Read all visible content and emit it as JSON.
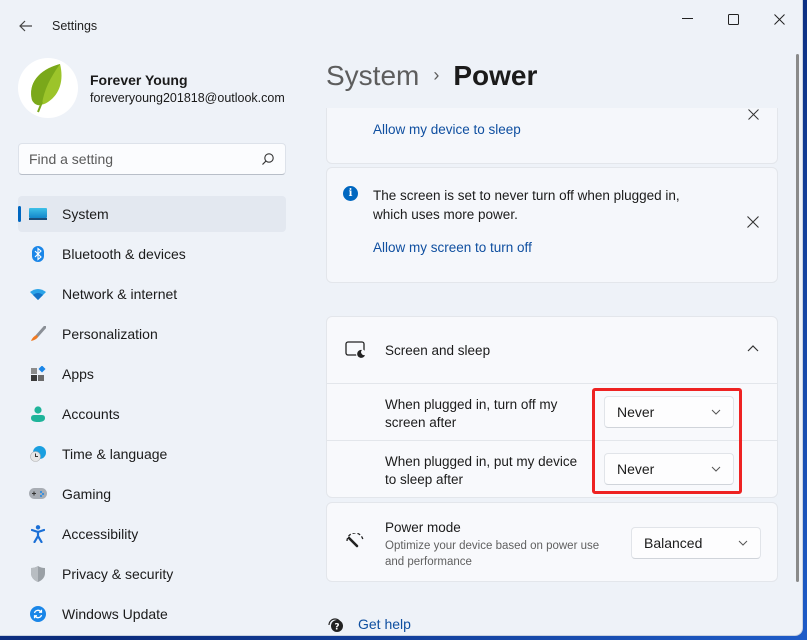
{
  "window": {
    "title": "Settings",
    "back_icon": "arrow-left-icon",
    "controls": {
      "minimize": "minimize-icon",
      "maximize": "maximize-icon",
      "close": "close-icon"
    }
  },
  "profile": {
    "name": "Forever Young",
    "email": "foreveryoung201818@outlook.com",
    "avatar_icon": "leaf-icon"
  },
  "search": {
    "placeholder": "Find a setting",
    "value": "",
    "icon": "search-icon"
  },
  "sidebar": {
    "items": [
      {
        "label": "System",
        "icon": "system-display-icon",
        "active": true
      },
      {
        "label": "Bluetooth & devices",
        "icon": "bluetooth-icon",
        "active": false
      },
      {
        "label": "Network & internet",
        "icon": "wifi-icon",
        "active": false
      },
      {
        "label": "Personalization",
        "icon": "paintbrush-icon",
        "active": false
      },
      {
        "label": "Apps",
        "icon": "apps-icon",
        "active": false
      },
      {
        "label": "Accounts",
        "icon": "person-icon",
        "active": false
      },
      {
        "label": "Time & language",
        "icon": "clock-globe-icon",
        "active": false
      },
      {
        "label": "Gaming",
        "icon": "gamepad-icon",
        "active": false
      },
      {
        "label": "Accessibility",
        "icon": "accessibility-icon",
        "active": false
      },
      {
        "label": "Privacy & security",
        "icon": "shield-icon",
        "active": false
      },
      {
        "label": "Windows Update",
        "icon": "update-sync-icon",
        "active": false
      }
    ]
  },
  "breadcrumb": {
    "parent": "System",
    "separator": "›",
    "current": "Power"
  },
  "notices": {
    "sleep": {
      "link": "Allow my device to sleep"
    },
    "screen": {
      "message": "The screen is set to never turn off when plugged in, which uses more power.",
      "link": "Allow my screen to turn off"
    }
  },
  "screen_and_sleep": {
    "title": "Screen and sleep",
    "expanded": true,
    "rows": [
      {
        "label": "When plugged in, turn off my screen after",
        "value": "Never"
      },
      {
        "label": "When plugged in, put my device to sleep after",
        "value": "Never"
      }
    ]
  },
  "power_mode": {
    "title": "Power mode",
    "description": "Optimize your device based on power use and performance",
    "value": "Balanced"
  },
  "help": {
    "label": "Get help"
  },
  "colors": {
    "accent": "#0067c0",
    "link": "#0f4fa0",
    "highlight": "#ee2222"
  }
}
